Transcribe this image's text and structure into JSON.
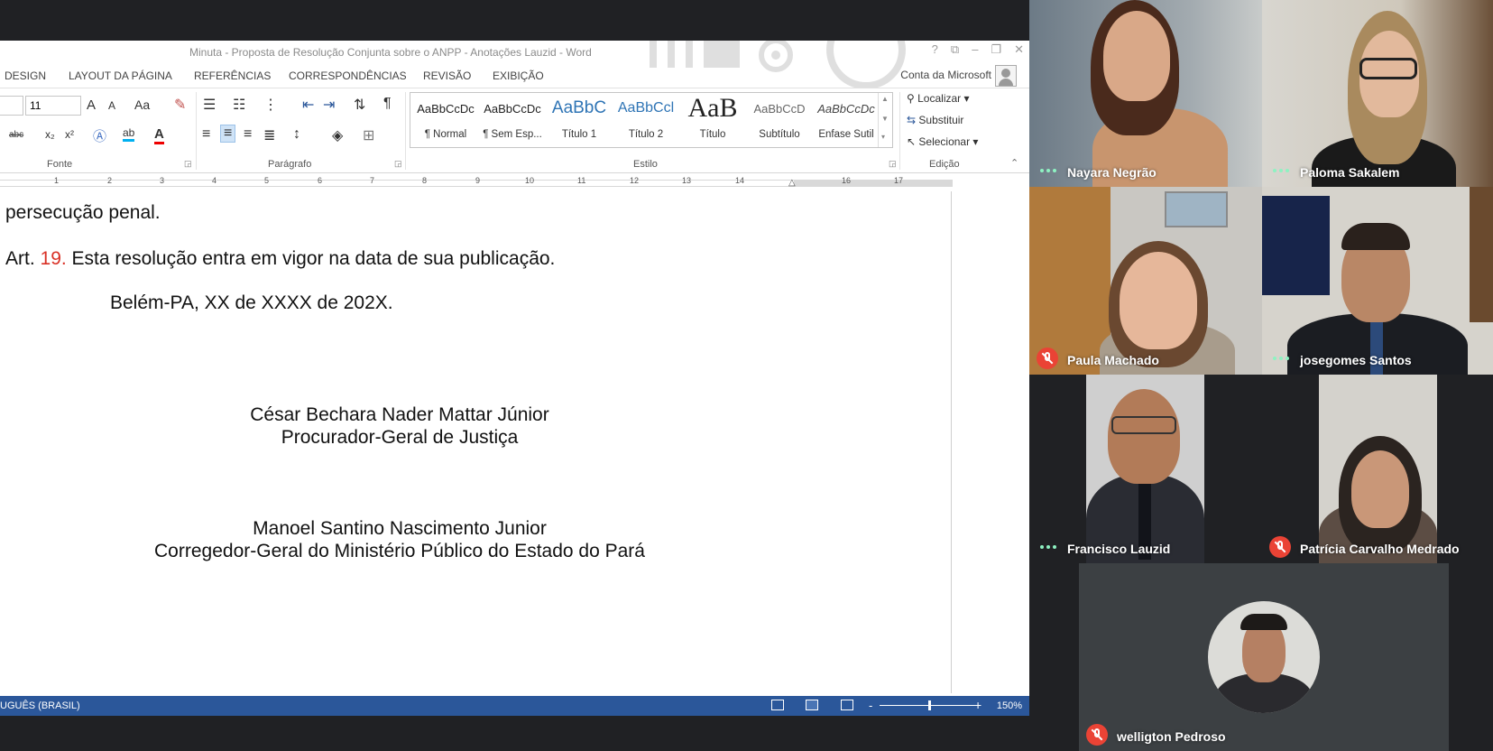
{
  "word": {
    "window_title": "Minuta - Proposta de Resolução Conjunta sobre o ANPP - Anotações Lauzid - Word",
    "window_buttons": [
      "?",
      "⧉",
      "–",
      "❐",
      "✕"
    ],
    "tabs": [
      "DESIGN",
      "LAYOUT DA PÁGINA",
      "REFERÊNCIAS",
      "CORRESPONDÊNCIAS",
      "REVISÃO",
      "EXIBIÇÃO"
    ],
    "account": "Conta da Microsoft",
    "ribbon": {
      "font_size": "11",
      "group_fonte": "Fonte",
      "group_paragrafo": "Parágrafo",
      "group_estilo": "Estilo",
      "group_edicao": "Edição",
      "grow_font": "A",
      "shrink_font": "A",
      "change_case": "Aa",
      "pilcrow": "¶",
      "strike": "abc",
      "subscript": "x₂",
      "superscript": "x²",
      "font_color": "A",
      "styles": [
        {
          "sample": "AaBbCcDc",
          "name": "¶ Normal"
        },
        {
          "sample": "AaBbCcDc",
          "name": "¶ Sem Esp..."
        },
        {
          "sample": "AaBbC",
          "name": "Título 1"
        },
        {
          "sample": "AaBbCcl",
          "name": "Título 2"
        },
        {
          "sample": "AaB",
          "name": "Título"
        },
        {
          "sample": "AaBbCcD",
          "name": "Subtítulo"
        },
        {
          "sample": "AaBbCcDc",
          "name": "Ênfase Sutil"
        }
      ],
      "localizar": "Localizar",
      "substituir": "Substituir",
      "selecionar": "Selecionar"
    },
    "ruler_numbers": [
      "1",
      "2",
      "3",
      "4",
      "5",
      "6",
      "7",
      "8",
      "9",
      "10",
      "11",
      "12",
      "13",
      "14",
      "16",
      "17"
    ],
    "document": {
      "line1": "persecução penal.",
      "art_prefix": "Art. ",
      "art_number": "19.",
      "art_text": " Esta resolução entra em vigor na data de sua publicação.",
      "place_date": "Belém-PA, XX de XXXX de 202X.",
      "sig1_name": "César Bechara Nader Mattar Júnior",
      "sig1_title": "Procurador-Geral de Justiça",
      "sig2_name": "Manoel Santino Nascimento Junior",
      "sig2_title": "Corregedor-Geral do Ministério Público do Estado do Pará"
    },
    "status": {
      "language": "UGUÊS (BRASIL)",
      "zoom": "150%",
      "zoom_minus": "-",
      "zoom_plus": "+"
    }
  },
  "participants": [
    {
      "name": "Nayara Negrão",
      "muted": false
    },
    {
      "name": "Paloma Sakalem",
      "muted": false
    },
    {
      "name": "Paula Machado",
      "muted": true
    },
    {
      "name": "josegomes Santos",
      "muted": false
    },
    {
      "name": "Francisco Lauzid",
      "muted": false
    },
    {
      "name": "Patrícia Carvalho Medrado",
      "muted": true
    },
    {
      "name": "welligton Pedroso",
      "muted": true
    }
  ],
  "colors": {
    "meeting_bg": "#202124",
    "status_bar": "#2b579a",
    "mute_red": "#ea4335",
    "speaking_dots": "#8ef2c2",
    "article_number_red": "#d93025"
  }
}
